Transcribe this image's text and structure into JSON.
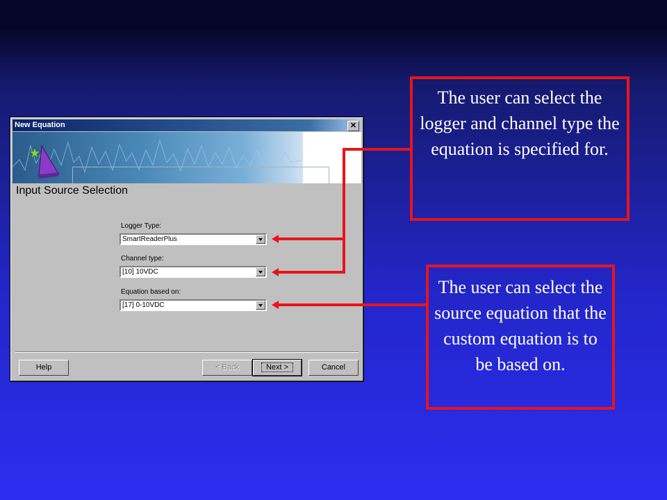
{
  "dialog": {
    "title": "New Equation",
    "close_glyph": "✕",
    "heading": "Input Source Selection",
    "fields": {
      "logger_type": {
        "label": "Logger Type:",
        "value": "SmartReaderPlus"
      },
      "channel_type": {
        "label": "Channel type:",
        "value": "[10] 10VDC"
      },
      "equation_based_on": {
        "label": "Equation based on:",
        "value": "[17] 0-10VDC"
      }
    },
    "buttons": {
      "help": "Help",
      "back": "< Back",
      "next": "Next >",
      "cancel": "Cancel"
    }
  },
  "callouts": {
    "logger": "The user can select the logger and channel type the equation is specified for.",
    "source": "The user can select the source equation that the custom equation is to be based on."
  },
  "colors": {
    "callout_border": "#e8141c",
    "background": "#2b2ef0",
    "titlebar": "#0a246a"
  }
}
